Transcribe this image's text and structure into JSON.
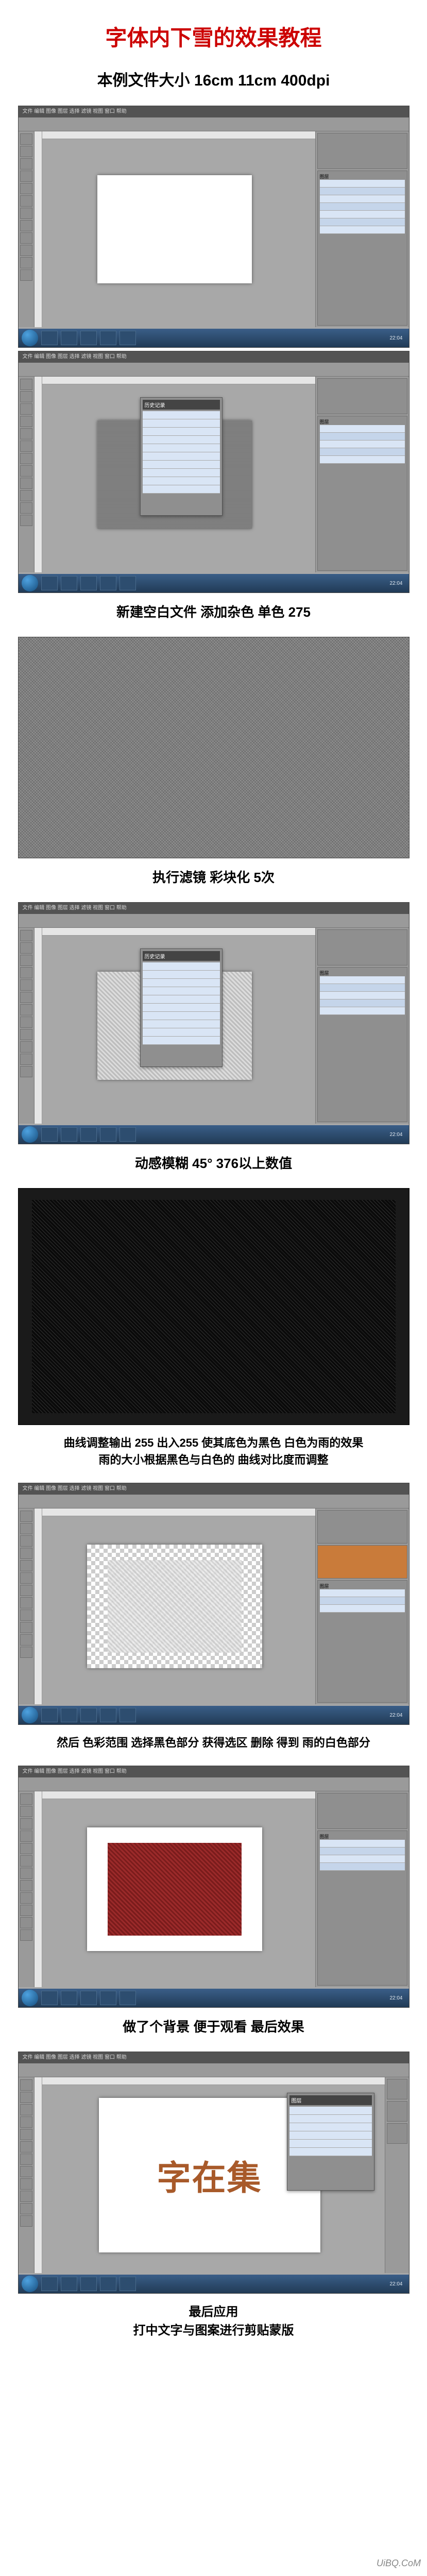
{
  "title": "字体内下雪的效果教程",
  "subtitle": "本例文件大小 16cm  11cm   400dpi",
  "captions": {
    "c2": "新建空白文件  添加杂色   单色   275",
    "c3": "执行滤镜 彩块化   5次",
    "c4": "动感模糊 45°   376以上数值",
    "c5a": "曲线调整输出 255 出入255  使其底色为黑色  白色为雨的效果",
    "c5b": "雨的大小根据黑色与白色的 曲线对比度而调整",
    "c6": "然后 色彩范围  选择黑色部分  获得选区  删除 得到 雨的白色部分",
    "c7": "做了个背景 便于观看 最后效果",
    "c8a": "最后应用",
    "c8b": "打中文字与图案进行剪贴蒙版"
  },
  "photoshop": {
    "menubar": "文件  编辑  图像  图层  选择  滤镜  视图  窗口  帮助",
    "layers_label": "图层",
    "history_label": "历史记录"
  },
  "taskbar_time": "22:04",
  "final_canvas_text": "字在集",
  "watermark": "UiBQ.CoM"
}
